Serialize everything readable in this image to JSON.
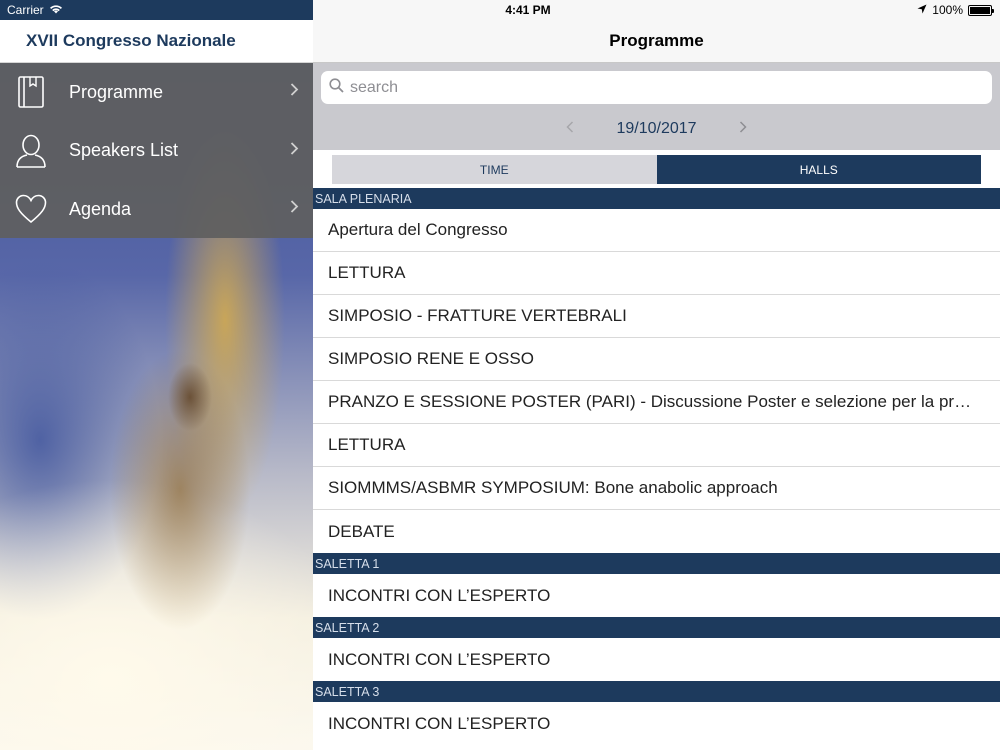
{
  "status": {
    "carrier": "Carrier",
    "time": "4:41 PM",
    "battery": "100%"
  },
  "sidebar": {
    "title": "XVII Congresso Nazionale",
    "items": [
      {
        "label": "Programme",
        "icon": "book-icon"
      },
      {
        "label": "Speakers List",
        "icon": "person-icon"
      },
      {
        "label": "Agenda",
        "icon": "heart-icon"
      }
    ]
  },
  "main": {
    "title": "Programme",
    "search": {
      "placeholder": "search",
      "value": ""
    },
    "date": "19/10/2017",
    "segments": [
      {
        "label": "TIME",
        "selected": false
      },
      {
        "label": "HALLS",
        "selected": true
      }
    ],
    "sections": [
      {
        "name": "SALA PLENARIA",
        "rows": [
          "Apertura del Congresso",
          "LETTURA",
          "SIMPOSIO - FRATTURE VERTEBRALI",
          "SIMPOSIO RENE E OSSO",
          "PRANZO E SESSIONE POSTER (PARI) - Discussione Poster e selezione per la prese…",
          "LETTURA",
          "SIOMMMS/ASBMR SYMPOSIUM: Bone anabolic approach",
          "DEBATE"
        ]
      },
      {
        "name": "SALETTA 1",
        "rows": [
          "INCONTRI CON L’ESPERTO"
        ]
      },
      {
        "name": "SALETTA 2",
        "rows": [
          "INCONTRI CON L’ESPERTO"
        ]
      },
      {
        "name": "SALETTA 3",
        "rows": [
          "INCONTRI CON L’ESPERTO"
        ]
      }
    ]
  },
  "colors": {
    "accent": "#1d3a5d",
    "menu_bg": "#5f5f5f",
    "search_bar_bg": "#c9c9ce"
  }
}
